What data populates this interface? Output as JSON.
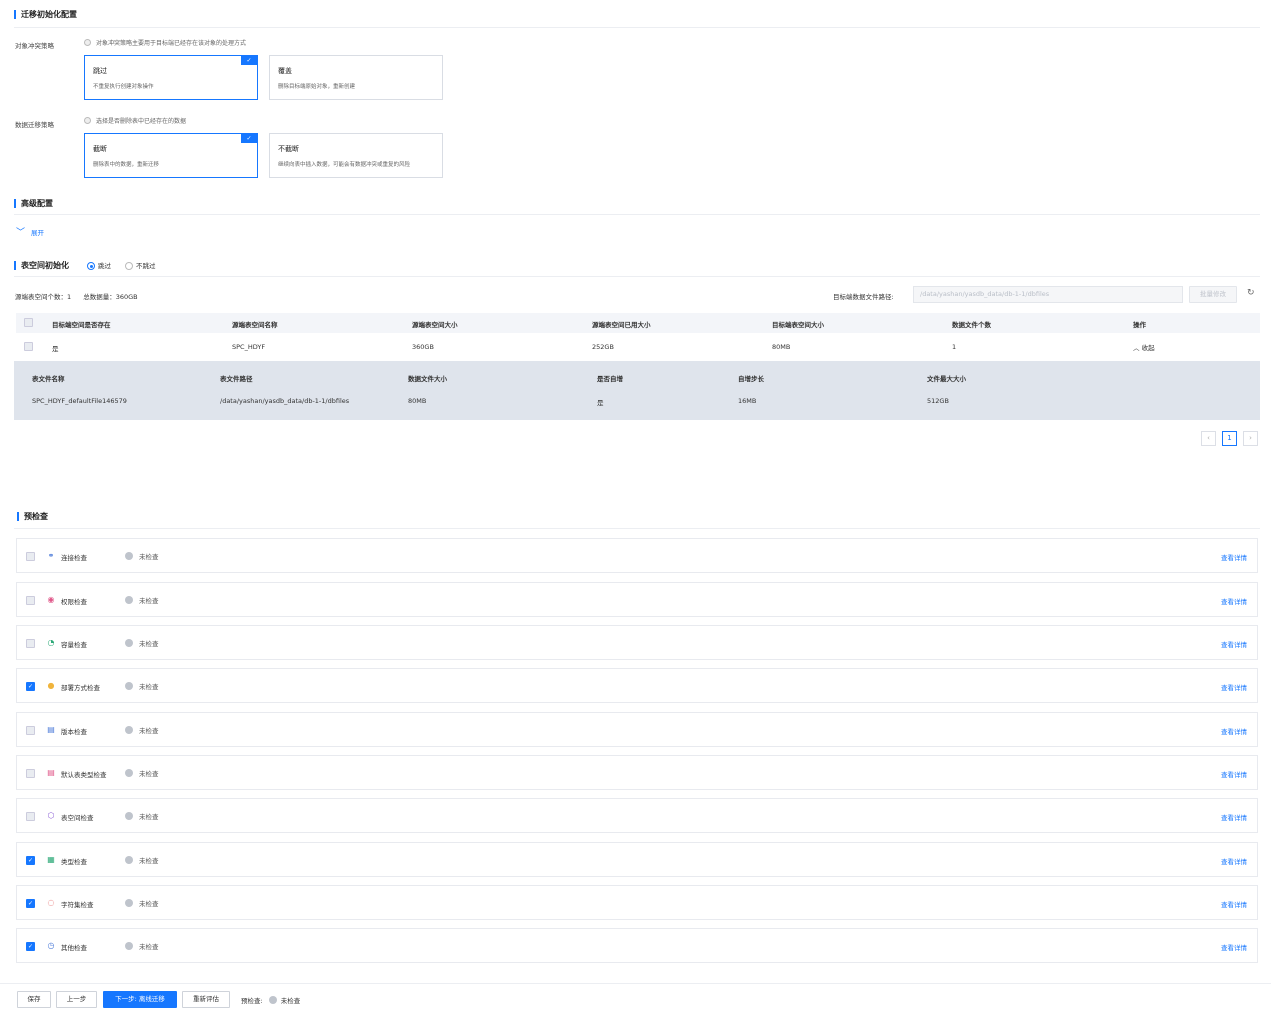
{
  "migration_init": {
    "title": "迁移初始化配置",
    "object_conflict": {
      "label": "对象冲突策略",
      "hint": "对象冲突策略主要用于目标端已经存在该对象的处理方式",
      "options": [
        {
          "title": "跳过",
          "desc": "不重复执行创建对象操作",
          "selected": true
        },
        {
          "title": "覆盖",
          "desc": "删除目标端原始对象，重新创建",
          "selected": false
        }
      ]
    },
    "data_migration": {
      "label": "数据迁移策略",
      "hint": "选择是否删除表中已经存在的数据",
      "options": [
        {
          "title": "截断",
          "desc": "删除表中的数据，重新迁移",
          "selected": true
        },
        {
          "title": "不截断",
          "desc": "继续向表中插入数据，可能会有数据冲突或重复的风险",
          "selected": false
        }
      ]
    }
  },
  "advanced": {
    "title": "高级配置",
    "expand_label": "展开"
  },
  "tablespace": {
    "title": "表空间初始化",
    "radio_skip": "跳过",
    "radio_noskip": "不跳过",
    "summary_count_label": "源端表空间个数：",
    "summary_count": "1",
    "summary_total_label": "总数据量：",
    "summary_total": "360GB",
    "target_path_label": "目标端数据文件路径:",
    "target_path_value": "/data/yashan/yasdb_data/db-1-1/dbfiles",
    "batch_button": "批量修改",
    "columns": [
      "目标端空间是否存在",
      "源端表空间名称",
      "源端表空间大小",
      "源端表空间已用大小",
      "目标端表空间大小",
      "数据文件个数",
      "操作"
    ],
    "rows": [
      {
        "exists": "是",
        "name": "SPC_HDYF",
        "size": "360GB",
        "used": "252GB",
        "target_size": "80MB",
        "file_count": "1",
        "action": "收起"
      }
    ],
    "sub_columns": [
      "表文件名称",
      "表文件路径",
      "数据文件大小",
      "是否自增",
      "自增步长",
      "文件最大大小"
    ],
    "sub_row": {
      "file_name": "SPC_HDYF_defaultFile146579",
      "file_path": "/data/yashan/yasdb_data/db-1-1/dbfiles",
      "file_size": "80MB",
      "auto_ext": "是",
      "step": "16MB",
      "max_size": "512GB"
    },
    "pager": {
      "prev": "‹",
      "page": "1",
      "next": "›"
    }
  },
  "precheck": {
    "title": "预检查",
    "status_text": "未检查",
    "detail_text": "查看详情",
    "items": [
      {
        "name": "连接检查",
        "icon": "link-icon",
        "icon_glyph": "⚭",
        "icon_color": "#4c7bd9",
        "checked": false
      },
      {
        "name": "权限检查",
        "icon": "permission-icon",
        "icon_glyph": "◉",
        "icon_color": "#e0588a",
        "checked": false
      },
      {
        "name": "容量检查",
        "icon": "capacity-icon",
        "icon_glyph": "◔",
        "icon_color": "#2aa876",
        "checked": false
      },
      {
        "name": "部署方式检查",
        "icon": "deploy-icon",
        "icon_glyph": "●",
        "icon_color": "#f0b43c",
        "checked": true
      },
      {
        "name": "版本检查",
        "icon": "version-icon",
        "icon_glyph": "▤",
        "icon_color": "#4c7bd9",
        "checked": false
      },
      {
        "name": "默认表类型检查",
        "icon": "table-type-icon",
        "icon_glyph": "▤",
        "icon_color": "#e0588a",
        "checked": false
      },
      {
        "name": "表空间检查",
        "icon": "tablespace-icon",
        "icon_glyph": "⬡",
        "icon_color": "#8a5cd6",
        "checked": false
      },
      {
        "name": "类型检查",
        "icon": "type-icon",
        "icon_glyph": "▦",
        "icon_color": "#2aa876",
        "checked": true
      },
      {
        "name": "字符集检查",
        "icon": "charset-icon",
        "icon_glyph": "◌",
        "icon_color": "#e05050",
        "checked": true
      },
      {
        "name": "其他检查",
        "icon": "other-icon",
        "icon_glyph": "◷",
        "icon_color": "#4c7bd9",
        "checked": true
      }
    ]
  },
  "footer": {
    "save": "保存",
    "prev": "上一步",
    "next": "下一步: 离线迁移",
    "reevaluate": "重新评估",
    "precheck_label": "预检查:",
    "precheck_status": "未检查"
  },
  "colors": {
    "accent": "#1677ff"
  }
}
